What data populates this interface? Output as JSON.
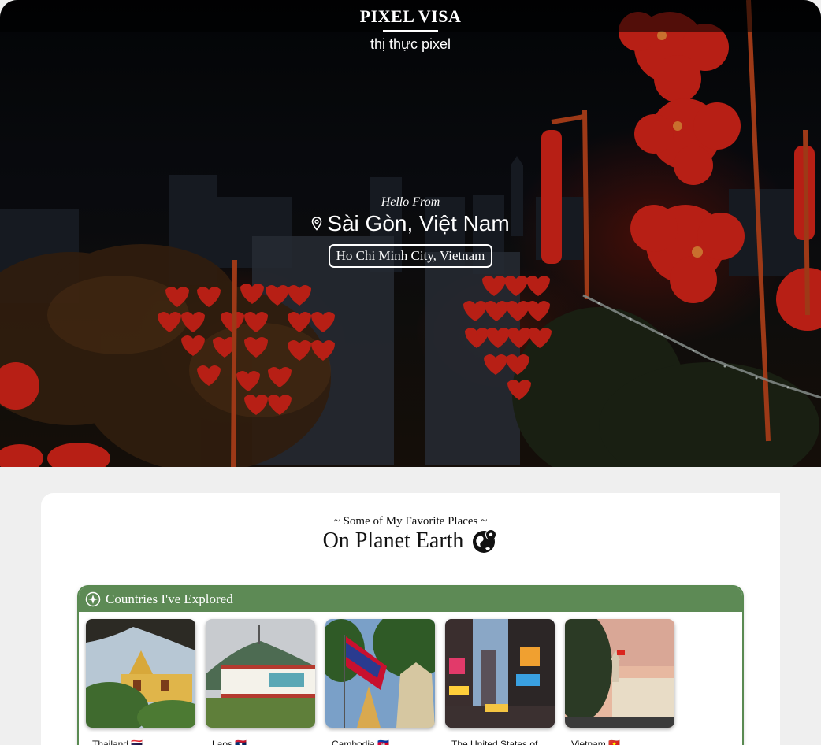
{
  "brand": {
    "title": "PIXEL VISA",
    "subtitle": "thị thực pixel"
  },
  "hero": {
    "kicker": "Hello From",
    "city": "Sài Gòn, Việt Nam",
    "tag": "Ho Chi Minh City, Vietnam"
  },
  "favorites": {
    "kicker": "~ Some of My Favorite Places ~",
    "title": "On Planet Earth"
  },
  "panel": {
    "title": "Countries I've Explored",
    "countries": [
      {
        "label": "Thailand 🇹🇭"
      },
      {
        "label": "Laos 🇱🇦"
      },
      {
        "label": "Cambodia 🇰🇭"
      },
      {
        "label": "The United States of"
      },
      {
        "label": "Vietnam 🇻🇳"
      }
    ]
  },
  "colors": {
    "panel_green": "#5d8a55",
    "lantern_red": "#e0261a"
  }
}
